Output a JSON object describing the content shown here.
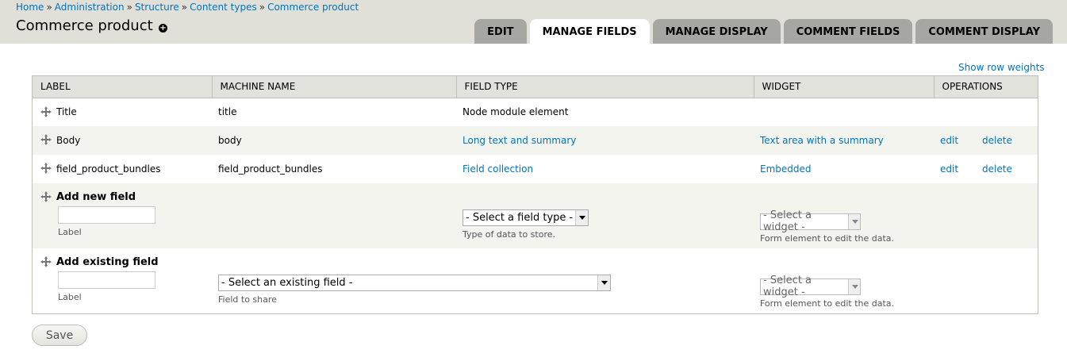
{
  "breadcrumb": [
    "Home",
    "Administration",
    "Structure",
    "Content types",
    "Commerce product"
  ],
  "breadcrumb_sep": "»",
  "page": {
    "title": "Commerce product"
  },
  "tabs": [
    "Edit",
    "Manage fields",
    "Manage display",
    "Comment fields",
    "Comment display"
  ],
  "active_tab": "Manage fields",
  "show_row_weights": "Show row weights",
  "table": {
    "headers": [
      "Label",
      "Machine name",
      "Field type",
      "Widget",
      "Operations"
    ],
    "rows": [
      {
        "label": "Title",
        "machine_name": "title",
        "field_type": "Node module element",
        "widget": "",
        "edit": "",
        "delete": ""
      },
      {
        "label": "Body",
        "machine_name": "body",
        "field_type": "Long text and summary",
        "widget": "Text area with a summary",
        "edit": "edit",
        "delete": "delete"
      },
      {
        "label": "field_product_bundles",
        "machine_name": "field_product_bundles",
        "field_type": "Field collection",
        "widget": "Embedded",
        "edit": "edit",
        "delete": "delete"
      }
    ]
  },
  "add_new": {
    "title": "Add new field",
    "label_value": "",
    "label_desc": "Label",
    "type_select": "- Select a field type -",
    "type_desc": "Type of data to store.",
    "widget_select": "- Select a widget -",
    "widget_desc": "Form element to edit the data."
  },
  "add_existing": {
    "title": "Add existing field",
    "label_value": "",
    "label_desc": "Label",
    "field_select": "- Select an existing field -",
    "field_desc": "Field to share",
    "widget_select": "- Select a widget -",
    "widget_desc": "Form element to edit the data."
  },
  "save_label": "Save"
}
